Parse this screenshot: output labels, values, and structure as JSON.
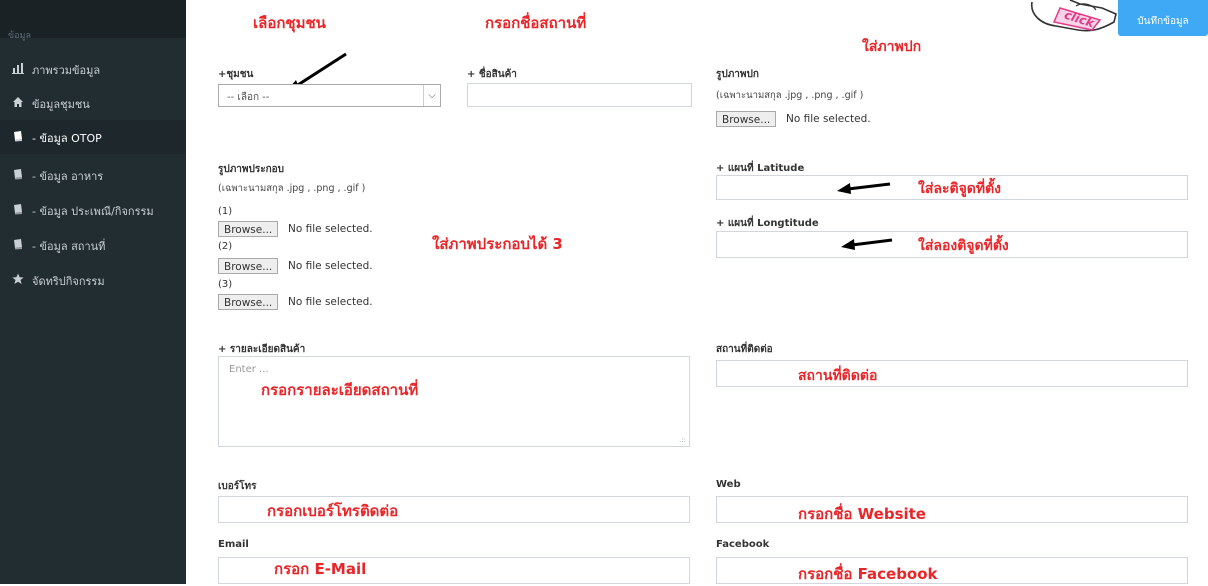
{
  "sidebar": {
    "top_label": "ข้อมูล",
    "items": [
      {
        "label": "ภาพรวมข้อมูล",
        "icon": "bar-chart-icon"
      },
      {
        "label": "ข้อมูลชุมชน",
        "icon": "home-icon"
      },
      {
        "label": "- ข้อมูล OTOP",
        "icon": "book-icon",
        "active": true
      },
      {
        "label": "- ข้อมูล อาหาร",
        "icon": "book-icon"
      },
      {
        "label": "- ข้อมูล ประเพณี/กิจกรรม",
        "icon": "book-icon"
      },
      {
        "label": "- ข้อมูล สถานที่",
        "icon": "book-icon"
      },
      {
        "label": "จัดทริปกิจกรรม",
        "icon": "star-icon"
      }
    ]
  },
  "save_button_label": "บันทึกข้อมูล",
  "form": {
    "community_label": "+ชุมชน",
    "community_selected": "-- เลือก --",
    "product_name_label": "+ ชื่อสินค้า",
    "cover_image_label": "รูปภาพปก",
    "cover_image_hint": "(เฉพาะนามสกุล .jpg , .png , .gif )",
    "browse_label": "Browse...",
    "no_file": "No file selected.",
    "extra_images_label": "รูปภาพประกอบ",
    "extra_images_hint": "(เฉพาะนามสกุล .jpg , .png , .gif )",
    "extra_nums": [
      "(1)",
      "(2)",
      "(3)"
    ],
    "lat_label": "+ แผนที่ Latitude",
    "lng_label": "+ แผนที่ Longtitude",
    "details_label": "+ รายละเอียดสินค้า",
    "details_placeholder": "Enter ...",
    "contact_place_label": "สถานที่ติดต่อ",
    "phone_label": "เบอร์โทร",
    "web_label": "Web",
    "email_label": "Email",
    "facebook_label": "Facebook"
  },
  "annotations": {
    "choose_community": "เลือกชุมชน",
    "fill_place_name": "กรอกชื่อสถานที่",
    "add_cover": "ใส่ภาพปก",
    "click": "click",
    "add_lat": "ใส่ละติจูดที่ตั้ง",
    "add_lng": "ใส่ลองติจูดที่ตั้ง",
    "add_3_images": "ใส่ภาพประกอบได้ 3",
    "fill_details": "กรอกรายละเอียดสถานที่",
    "contact_place": "สถานที่ติดต่อ",
    "fill_phone": "กรอกเบอร์โทรติดต่อ",
    "fill_website": "กรอกชื่อ Website",
    "fill_email": "กรอก E-Mail",
    "fill_facebook": "กรอกชื่อ Facebook"
  }
}
